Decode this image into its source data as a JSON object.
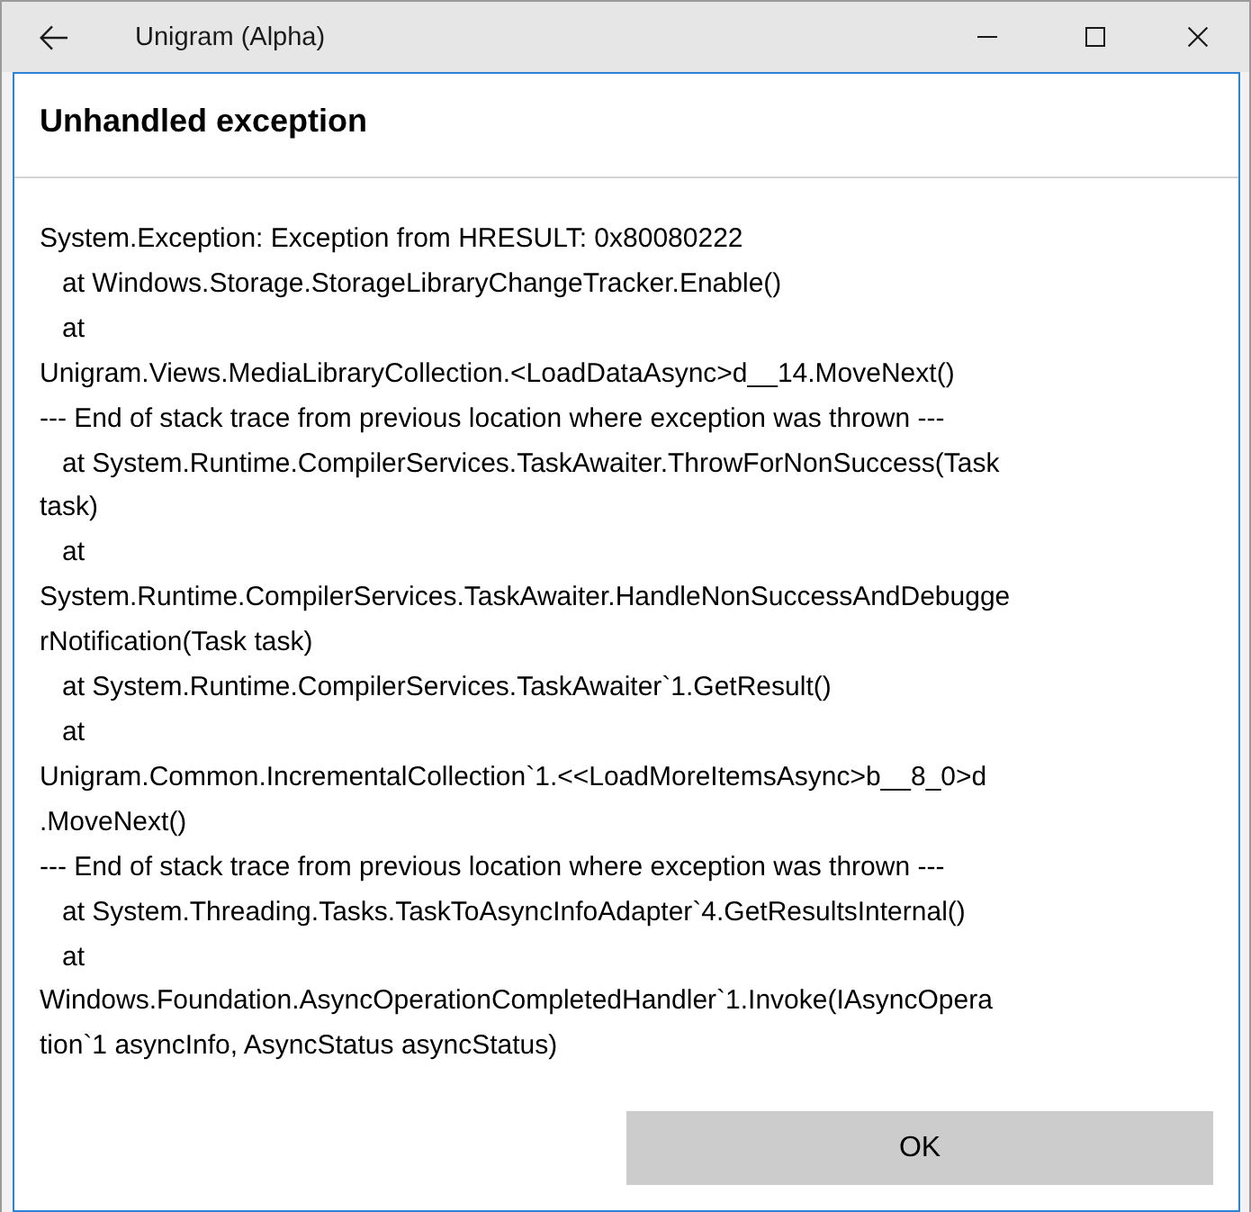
{
  "window": {
    "title": "Unigram (Alpha)"
  },
  "dialog": {
    "title": "Unhandled exception",
    "message_lines": [
      "System.Exception: Exception from HRESULT: 0x80080222",
      "   at Windows.Storage.StorageLibraryChangeTracker.Enable()",
      "   at",
      "Unigram.Views.MediaLibraryCollection.<LoadDataAsync>d__14.MoveNext()",
      "--- End of stack trace from previous location where exception was thrown ---",
      "   at System.Runtime.CompilerServices.TaskAwaiter.ThrowForNonSuccess(Task",
      "task)",
      "   at",
      "System.Runtime.CompilerServices.TaskAwaiter.HandleNonSuccessAndDebugge",
      "rNotification(Task task)",
      "   at System.Runtime.CompilerServices.TaskAwaiter`1.GetResult()",
      "   at",
      "Unigram.Common.IncrementalCollection`1.<<LoadMoreItemsAsync>b__8_0>d",
      ".MoveNext()",
      "--- End of stack trace from previous location where exception was thrown ---",
      "   at System.Threading.Tasks.TaskToAsyncInfoAdapter`4.GetResultsInternal()",
      "   at",
      "Windows.Foundation.AsyncOperationCompletedHandler`1.Invoke(IAsyncOpera",
      "tion`1 asyncInfo, AsyncStatus asyncStatus)"
    ],
    "buttons": [
      "OK"
    ]
  }
}
